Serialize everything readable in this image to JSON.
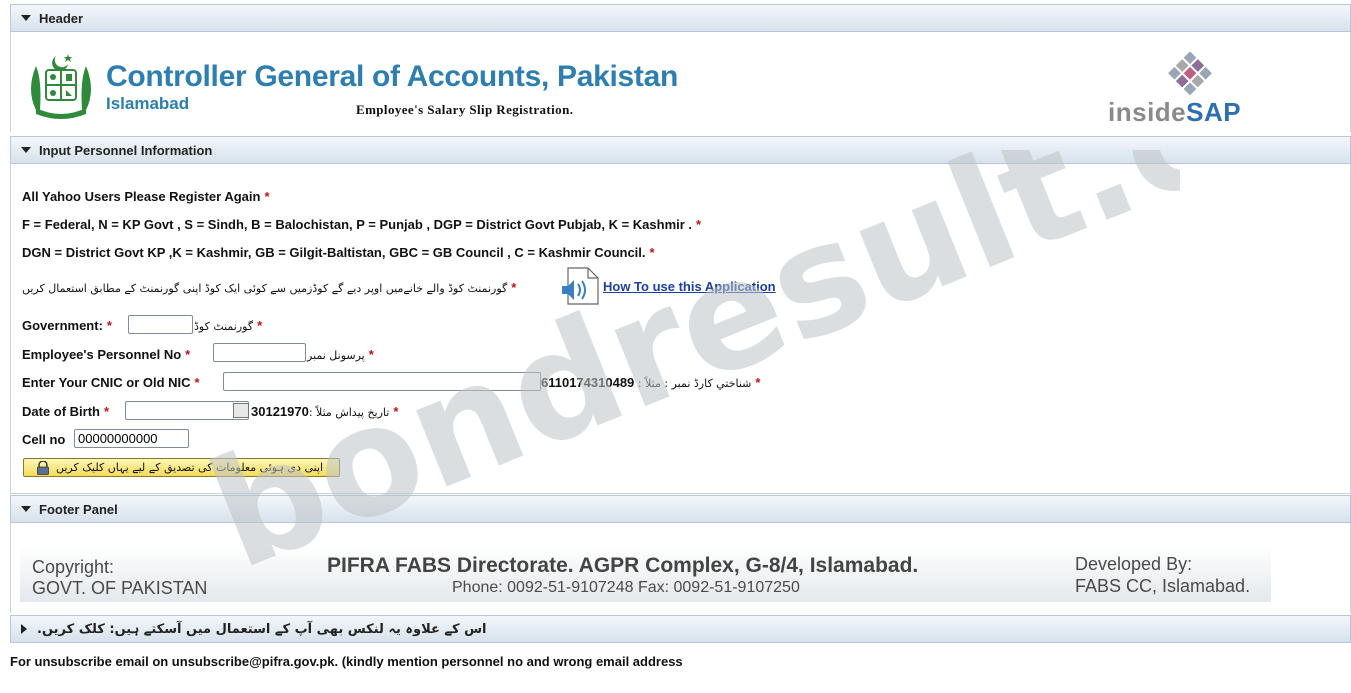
{
  "header_panel": {
    "title": "Header"
  },
  "banner": {
    "org_name": "Controller General of Accounts, Pakistan",
    "city": "Islamabad",
    "subtitle": "Employee's Salary Slip  Registration.",
    "partner_logo_text_1": "inside",
    "partner_logo_text_2": "SAP"
  },
  "personnel_panel": {
    "title": "Input Personnel Information",
    "notice_yahoo": "All Yahoo Users Please Register Again",
    "codes_line_1": "F = Federal, N = KP Govt , S = Sindh, B = Balochistan, P = Punjab , DGP = District Govt Pubjab, K = Kashmir .",
    "codes_line_2": "DGN = District Govt KP ,K = Kashmir, GB = Gilgit-Baltistan, GBC = GB Council , C = Kashmir Council.",
    "urdu_instruction": "گورنمنٹ کوڈ والے خانےمیں اوپر دیے گے کوڈزمیں سے کوئی ایک کوڈ اپنی گورنمنٹ کے مطابق استعمال کریں",
    "howto_link": "How To use this Application",
    "fields": {
      "government": {
        "label": "Government:",
        "urdu": "گورنمنٹ کوڈ",
        "value": ""
      },
      "personnel_no": {
        "label": "Employee's Personnel No",
        "urdu": "پرسونل نمبر",
        "value": ""
      },
      "cnic": {
        "label": "Enter Your CNIC or Old NIC",
        "example": "6110174310489",
        "urdu": "شناختي کارڈ نمبر : مثلاً :",
        "value": ""
      },
      "dob": {
        "label": "Date of Birth",
        "example": "30121970",
        "urdu": "تاریخ پیداش مثلاً :",
        "value": ""
      },
      "cell": {
        "label": "Cell no",
        "value": "00000000000"
      }
    },
    "verify_button": "اپنی دی ہوئی معلومات کی تصدیق کے لیے یہاں کلیک کریں"
  },
  "footer_panel": {
    "title": "Footer Panel",
    "copyright": "Copyright:",
    "govt": "GOVT. OF PAKISTAN",
    "directorate": "PIFRA FABS Directorate. AGPR Complex, G-8/4, Islamabad.",
    "phone": "Phone: 0092-51-9107248 Fax: 0092-51-9107250",
    "developed_by": "Developed By:",
    "developer": "FABS CC, Islamabad."
  },
  "links_panel": {
    "title": "اس کے علاوہ یہ لنکس بھی آپ کے استعمال میں آسکتے ہیں: کلک کریں."
  },
  "unsubscribe": "For unsubscribe email on unsubscribe@pifra.gov.pk. (kindly mention personnel no and wrong email address",
  "watermark": "bondresult.com",
  "colors": {
    "accent": "#2c7fb0",
    "required": "#c0141b",
    "link": "#1a3fa8"
  }
}
